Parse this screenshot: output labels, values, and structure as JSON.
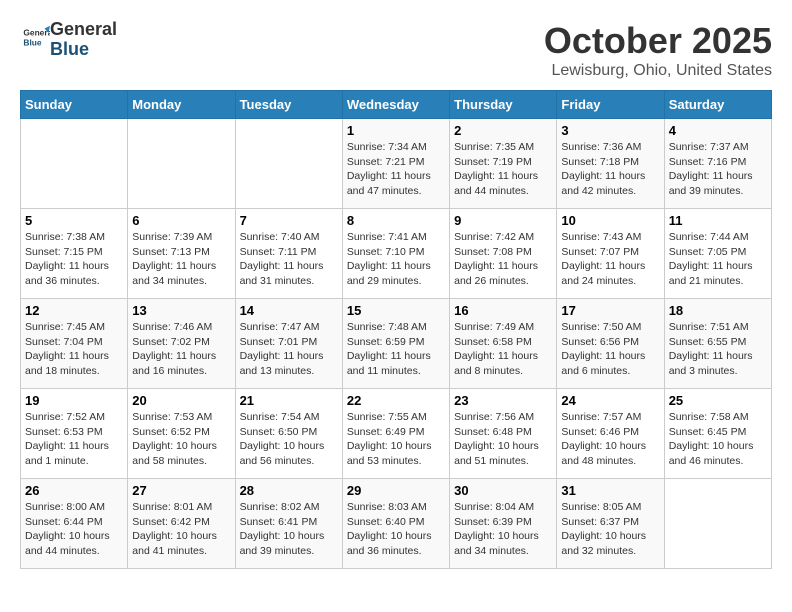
{
  "header": {
    "logo_general": "General",
    "logo_blue": "Blue",
    "month_title": "October 2025",
    "location": "Lewisburg, Ohio, United States"
  },
  "weekdays": [
    "Sunday",
    "Monday",
    "Tuesday",
    "Wednesday",
    "Thursday",
    "Friday",
    "Saturday"
  ],
  "weeks": [
    [
      {
        "day": "",
        "info": ""
      },
      {
        "day": "",
        "info": ""
      },
      {
        "day": "",
        "info": ""
      },
      {
        "day": "1",
        "info": "Sunrise: 7:34 AM\nSunset: 7:21 PM\nDaylight: 11 hours and 47 minutes."
      },
      {
        "day": "2",
        "info": "Sunrise: 7:35 AM\nSunset: 7:19 PM\nDaylight: 11 hours and 44 minutes."
      },
      {
        "day": "3",
        "info": "Sunrise: 7:36 AM\nSunset: 7:18 PM\nDaylight: 11 hours and 42 minutes."
      },
      {
        "day": "4",
        "info": "Sunrise: 7:37 AM\nSunset: 7:16 PM\nDaylight: 11 hours and 39 minutes."
      }
    ],
    [
      {
        "day": "5",
        "info": "Sunrise: 7:38 AM\nSunset: 7:15 PM\nDaylight: 11 hours and 36 minutes."
      },
      {
        "day": "6",
        "info": "Sunrise: 7:39 AM\nSunset: 7:13 PM\nDaylight: 11 hours and 34 minutes."
      },
      {
        "day": "7",
        "info": "Sunrise: 7:40 AM\nSunset: 7:11 PM\nDaylight: 11 hours and 31 minutes."
      },
      {
        "day": "8",
        "info": "Sunrise: 7:41 AM\nSunset: 7:10 PM\nDaylight: 11 hours and 29 minutes."
      },
      {
        "day": "9",
        "info": "Sunrise: 7:42 AM\nSunset: 7:08 PM\nDaylight: 11 hours and 26 minutes."
      },
      {
        "day": "10",
        "info": "Sunrise: 7:43 AM\nSunset: 7:07 PM\nDaylight: 11 hours and 24 minutes."
      },
      {
        "day": "11",
        "info": "Sunrise: 7:44 AM\nSunset: 7:05 PM\nDaylight: 11 hours and 21 minutes."
      }
    ],
    [
      {
        "day": "12",
        "info": "Sunrise: 7:45 AM\nSunset: 7:04 PM\nDaylight: 11 hours and 18 minutes."
      },
      {
        "day": "13",
        "info": "Sunrise: 7:46 AM\nSunset: 7:02 PM\nDaylight: 11 hours and 16 minutes."
      },
      {
        "day": "14",
        "info": "Sunrise: 7:47 AM\nSunset: 7:01 PM\nDaylight: 11 hours and 13 minutes."
      },
      {
        "day": "15",
        "info": "Sunrise: 7:48 AM\nSunset: 6:59 PM\nDaylight: 11 hours and 11 minutes."
      },
      {
        "day": "16",
        "info": "Sunrise: 7:49 AM\nSunset: 6:58 PM\nDaylight: 11 hours and 8 minutes."
      },
      {
        "day": "17",
        "info": "Sunrise: 7:50 AM\nSunset: 6:56 PM\nDaylight: 11 hours and 6 minutes."
      },
      {
        "day": "18",
        "info": "Sunrise: 7:51 AM\nSunset: 6:55 PM\nDaylight: 11 hours and 3 minutes."
      }
    ],
    [
      {
        "day": "19",
        "info": "Sunrise: 7:52 AM\nSunset: 6:53 PM\nDaylight: 11 hours and 1 minute."
      },
      {
        "day": "20",
        "info": "Sunrise: 7:53 AM\nSunset: 6:52 PM\nDaylight: 10 hours and 58 minutes."
      },
      {
        "day": "21",
        "info": "Sunrise: 7:54 AM\nSunset: 6:50 PM\nDaylight: 10 hours and 56 minutes."
      },
      {
        "day": "22",
        "info": "Sunrise: 7:55 AM\nSunset: 6:49 PM\nDaylight: 10 hours and 53 minutes."
      },
      {
        "day": "23",
        "info": "Sunrise: 7:56 AM\nSunset: 6:48 PM\nDaylight: 10 hours and 51 minutes."
      },
      {
        "day": "24",
        "info": "Sunrise: 7:57 AM\nSunset: 6:46 PM\nDaylight: 10 hours and 48 minutes."
      },
      {
        "day": "25",
        "info": "Sunrise: 7:58 AM\nSunset: 6:45 PM\nDaylight: 10 hours and 46 minutes."
      }
    ],
    [
      {
        "day": "26",
        "info": "Sunrise: 8:00 AM\nSunset: 6:44 PM\nDaylight: 10 hours and 44 minutes."
      },
      {
        "day": "27",
        "info": "Sunrise: 8:01 AM\nSunset: 6:42 PM\nDaylight: 10 hours and 41 minutes."
      },
      {
        "day": "28",
        "info": "Sunrise: 8:02 AM\nSunset: 6:41 PM\nDaylight: 10 hours and 39 minutes."
      },
      {
        "day": "29",
        "info": "Sunrise: 8:03 AM\nSunset: 6:40 PM\nDaylight: 10 hours and 36 minutes."
      },
      {
        "day": "30",
        "info": "Sunrise: 8:04 AM\nSunset: 6:39 PM\nDaylight: 10 hours and 34 minutes."
      },
      {
        "day": "31",
        "info": "Sunrise: 8:05 AM\nSunset: 6:37 PM\nDaylight: 10 hours and 32 minutes."
      },
      {
        "day": "",
        "info": ""
      }
    ]
  ]
}
